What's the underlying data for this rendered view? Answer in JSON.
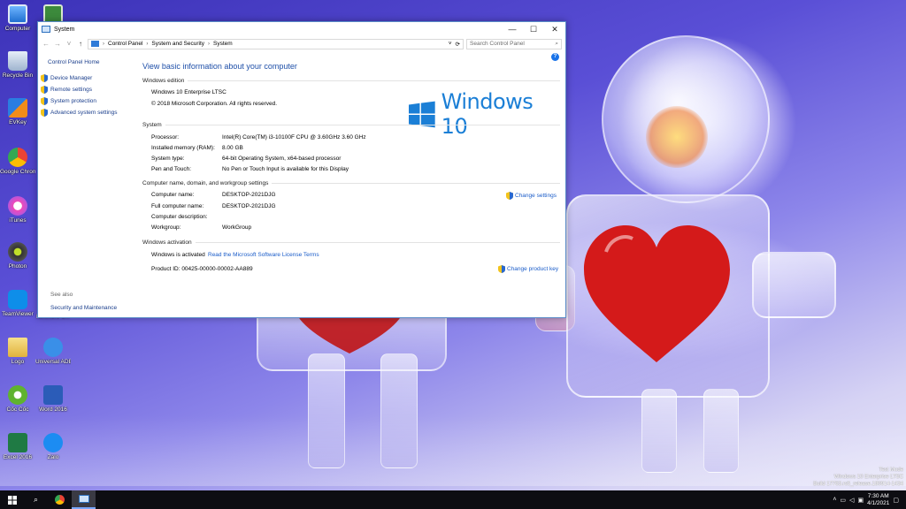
{
  "desktop": {
    "icons": [
      {
        "label": "Computer"
      },
      {
        "label": "Recycle Bin"
      },
      {
        "label": "EVKey"
      },
      {
        "label": "Google Chrome"
      },
      {
        "label": "iTunes"
      },
      {
        "label": "Photon"
      },
      {
        "label": "TeamViewer"
      },
      {
        "label": "Nimmers-S..."
      },
      {
        "label": "Logo"
      },
      {
        "label": "Universal ADB Drive..."
      },
      {
        "label": "Cốc Cốc"
      },
      {
        "label": "Word 2016"
      },
      {
        "label": "Excel 2016"
      },
      {
        "label": "Zalo"
      }
    ],
    "wallpaper_colors": {
      "primary": "#4a40c8",
      "light": "#e6e4fa",
      "heart": "#d41a1a"
    }
  },
  "window": {
    "title": "System",
    "controls": {
      "minimize": "—",
      "maximize": "☐",
      "close": "✕"
    },
    "breadcrumb": [
      "Control Panel",
      "System and Security",
      "System"
    ],
    "search_placeholder": "Search Control Panel",
    "left_panel": {
      "home": "Control Panel Home",
      "links": [
        "Device Manager",
        "Remote settings",
        "System protection",
        "Advanced system settings"
      ],
      "see_also": "See also",
      "see_also_links": [
        "Security and Maintenance"
      ]
    },
    "heading": "View basic information about your computer",
    "edition": {
      "title": "Windows edition",
      "name": "Windows 10 Enterprise LTSC",
      "copyright": "© 2018 Microsoft Corporation. All rights reserved.",
      "logo_text": "Windows 10"
    },
    "system": {
      "title": "System",
      "rows": [
        {
          "key": "Processor:",
          "value": "Intel(R) Core(TM) i3-10100F CPU @ 3.60GHz   3.60 GHz"
        },
        {
          "key": "Installed memory (RAM):",
          "value": "8.00 GB"
        },
        {
          "key": "System type:",
          "value": "64-bit Operating System, x64-based processor"
        },
        {
          "key": "Pen and Touch:",
          "value": "No Pen or Touch Input is available for this Display"
        }
      ]
    },
    "computer_name": {
      "title": "Computer name, domain, and workgroup settings",
      "change_link": "Change settings",
      "rows": [
        {
          "key": "Computer name:",
          "value": "DESKTOP-2021DJG"
        },
        {
          "key": "Full computer name:",
          "value": "DESKTOP-2021DJG"
        },
        {
          "key": "Computer description:",
          "value": ""
        },
        {
          "key": "Workgroup:",
          "value": "WorkGroup"
        }
      ]
    },
    "activation": {
      "title": "Windows activation",
      "status": "Windows is activated",
      "license_link": "Read the Microsoft Software License Terms",
      "product_id": "Product ID: 00425-00000-00002-AA889",
      "change_key": "Change product key"
    }
  },
  "watermark": {
    "line1": "Test Mode",
    "line2": "Windows 10 Enterprise LTSC",
    "line3": "Build 17763.rs5_release.180914-1434"
  },
  "taskbar": {
    "time": "7:30 AM",
    "date": "4/1/2021",
    "accent": "#7aa7ff"
  }
}
